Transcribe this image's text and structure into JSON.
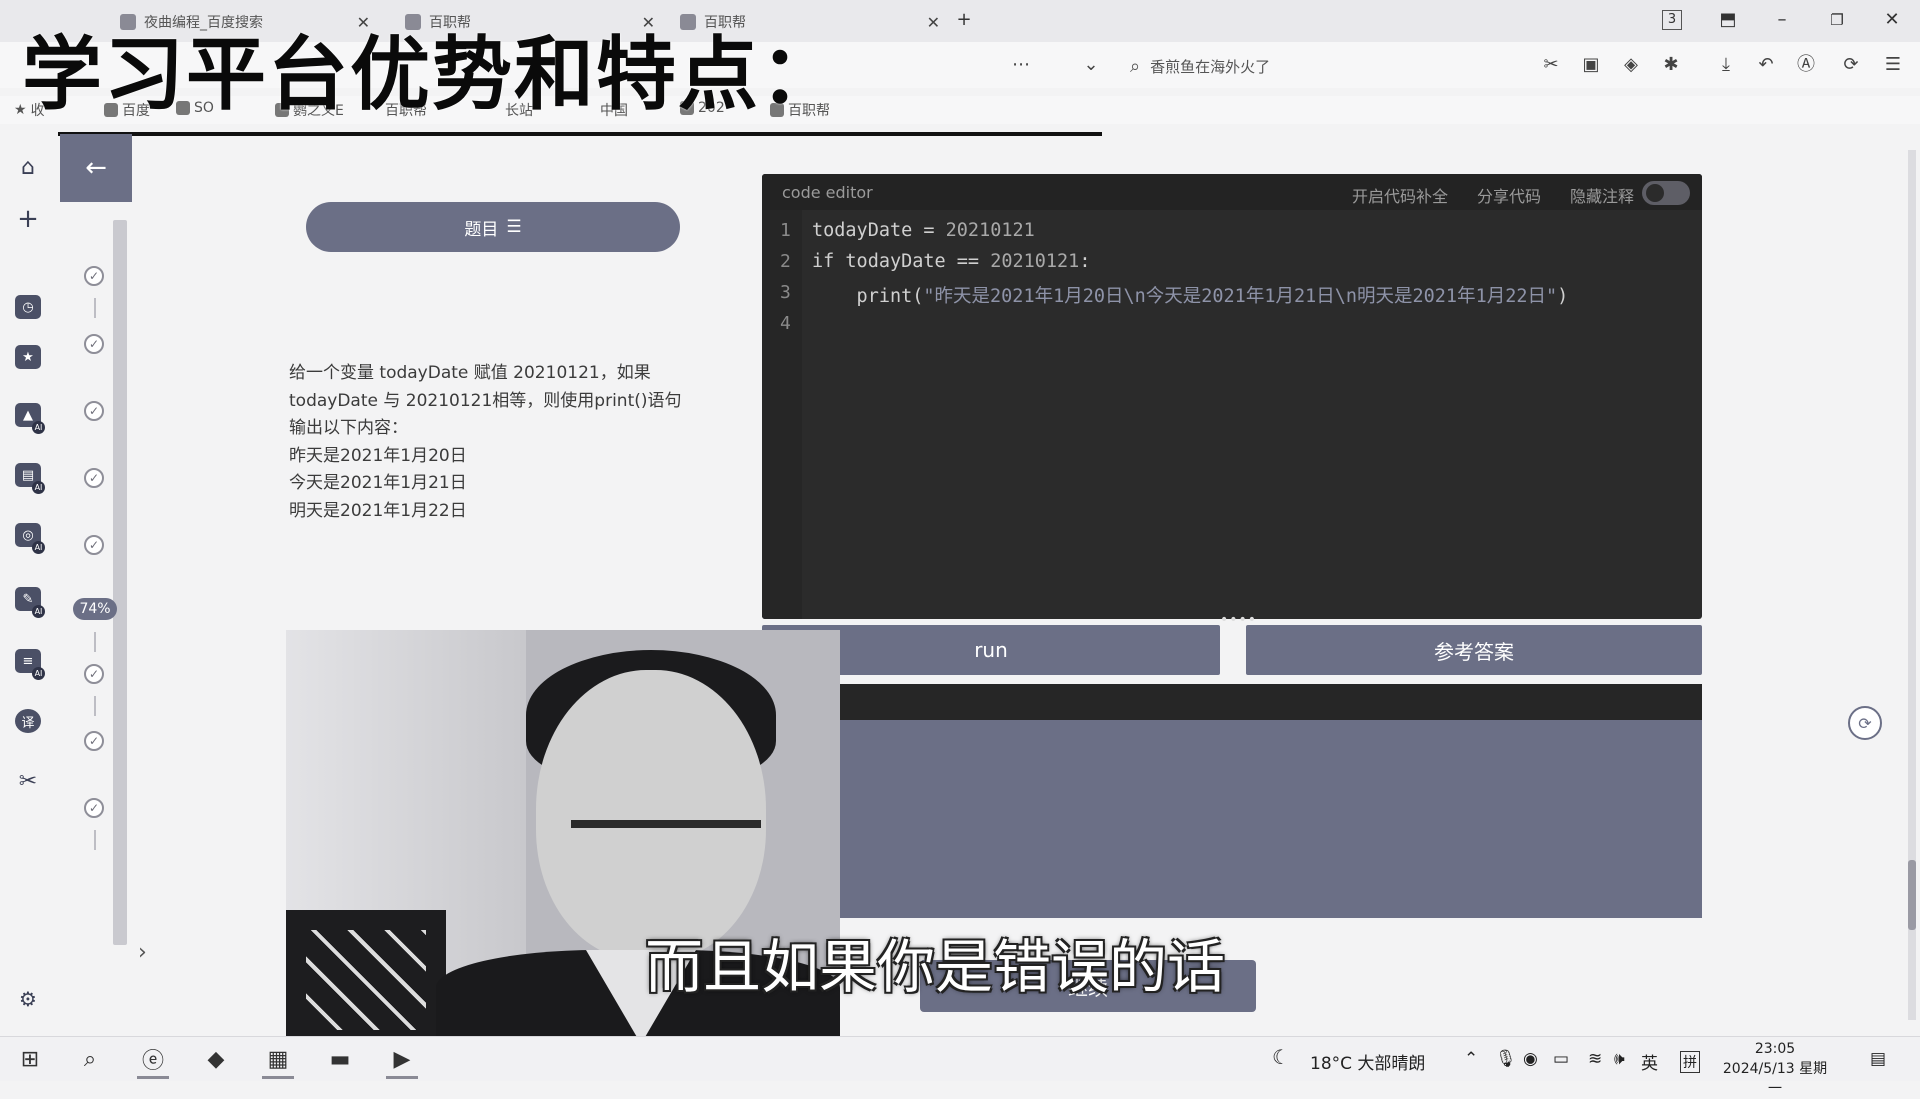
{
  "browser": {
    "tabs": [
      {
        "label": "夜曲编程_百度搜索"
      },
      {
        "label": "百职帮"
      },
      {
        "label": "百职帮"
      }
    ],
    "tab_count": "3",
    "search_placeholder": "香煎鱼在海外火了",
    "bookmarks": [
      "收",
      "百度",
      "SO",
      "鹦之义E",
      "百职帮",
      "长站",
      "中国",
      "202",
      "百职帮"
    ]
  },
  "overlay": {
    "title": "学习平台优势和特点："
  },
  "sidebar": {
    "progress": "74%"
  },
  "question": {
    "header": "题目",
    "header_icon": "list-icon",
    "lines": [
      "给一个变量 todayDate 赋值 20210121，如果",
      "todayDate 与 20210121相等，则使用print()语句",
      "输出以下内容：",
      "昨天是2021年1月20日",
      "今天是2021年1月21日",
      "明天是2021年1月22日"
    ]
  },
  "editor": {
    "title": "code editor",
    "autocomplete_label": "开启代码补全",
    "share_label": "分享代码",
    "hide_comments_label": "隐藏注释",
    "line_numbers": [
      "1",
      "2",
      "3",
      "4"
    ],
    "code": {
      "line1_pre": "todayDate = ",
      "line1_num": "20210121",
      "line2_pre": "if todayDate == ",
      "line2_num": "20210121",
      "line2_post": ":",
      "line3_pre": "    print(",
      "line3_str": "\"昨天是2021年1月20日\\n今天是2021年1月21日\\n明天是2021年1月22日\"",
      "line3_post": ")"
    }
  },
  "actions": {
    "run_label": "run",
    "answer_label": "参考答案",
    "continue_label": "继续"
  },
  "subtitle": "而且如果你是错误的话",
  "taskbar": {
    "weather": "18°C  大部晴朗",
    "ime": "英",
    "ime2": "拼",
    "time": "23:05",
    "date": "2024/5/13 星期一"
  }
}
